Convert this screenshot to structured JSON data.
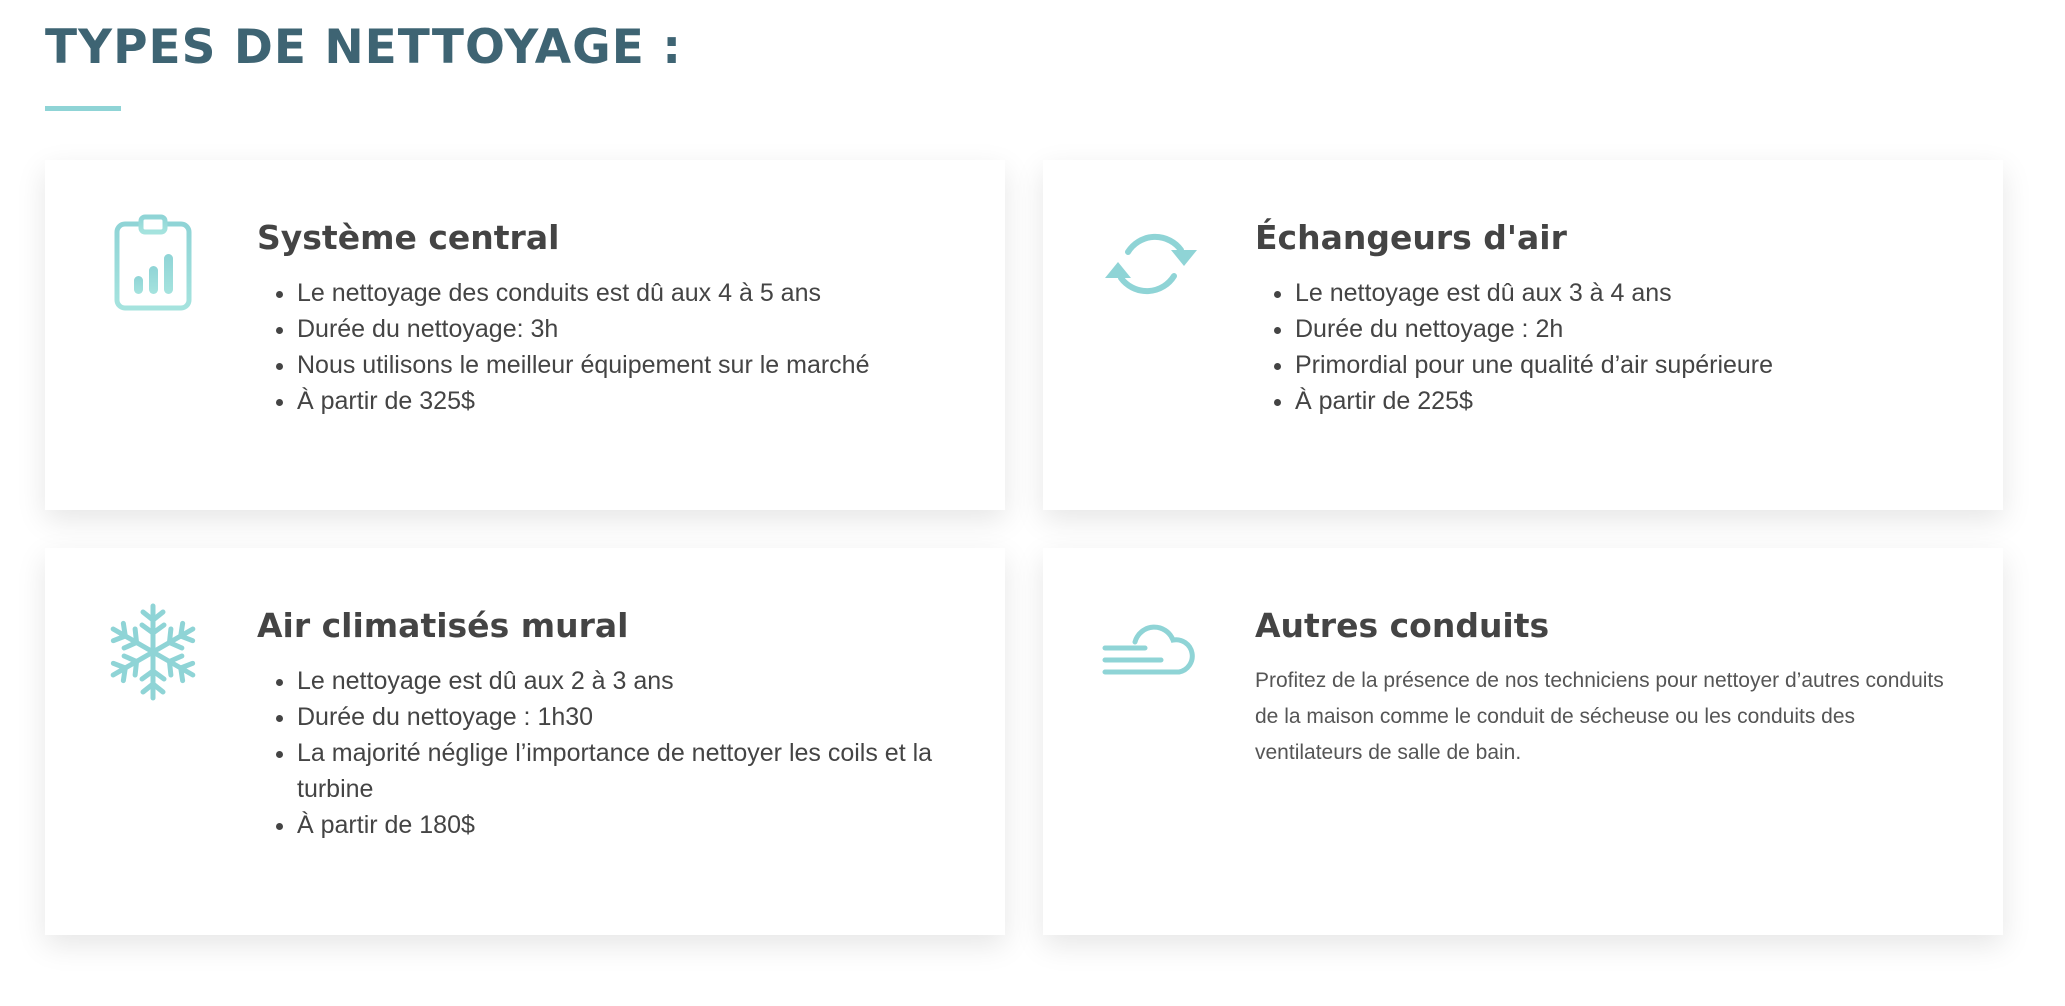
{
  "page": {
    "title": "TYPES DE NETTOYAGE :"
  },
  "colors": {
    "title": "#3e6473",
    "accent": "#8fd4d6",
    "text": "#444444"
  },
  "cards": [
    {
      "icon": "clipboard-chart-icon",
      "title": "Système central",
      "items": [
        "Le nettoyage des conduits est dû aux 4 à 5 ans",
        "Durée du nettoyage: 3h",
        "Nous utilisons le meilleur équipement sur le marché",
        "À partir de 325$"
      ]
    },
    {
      "icon": "refresh-arrows-icon",
      "title": "Échangeurs d'air",
      "items": [
        "Le nettoyage est dû aux 3 à 4 ans",
        "Durée du nettoyage : 2h",
        "Primordial pour une qualité d’air supérieure",
        "À partir de 225$"
      ]
    },
    {
      "icon": "snowflake-icon",
      "title": "Air climatisés mural",
      "items": [
        "Le nettoyage est dû aux 2 à 3 ans",
        "Durée du nettoyage : 1h30",
        "La majorité néglige l’importance de nettoyer les coils et la turbine",
        "À partir de 180$"
      ]
    },
    {
      "icon": "cloud-wind-icon",
      "title": "Autres conduits",
      "text": "Profitez de la présence de nos techniciens pour nettoyer d’autres conduits de la maison comme le conduit de sécheuse ou les conduits des ventilateurs de salle de bain."
    }
  ]
}
